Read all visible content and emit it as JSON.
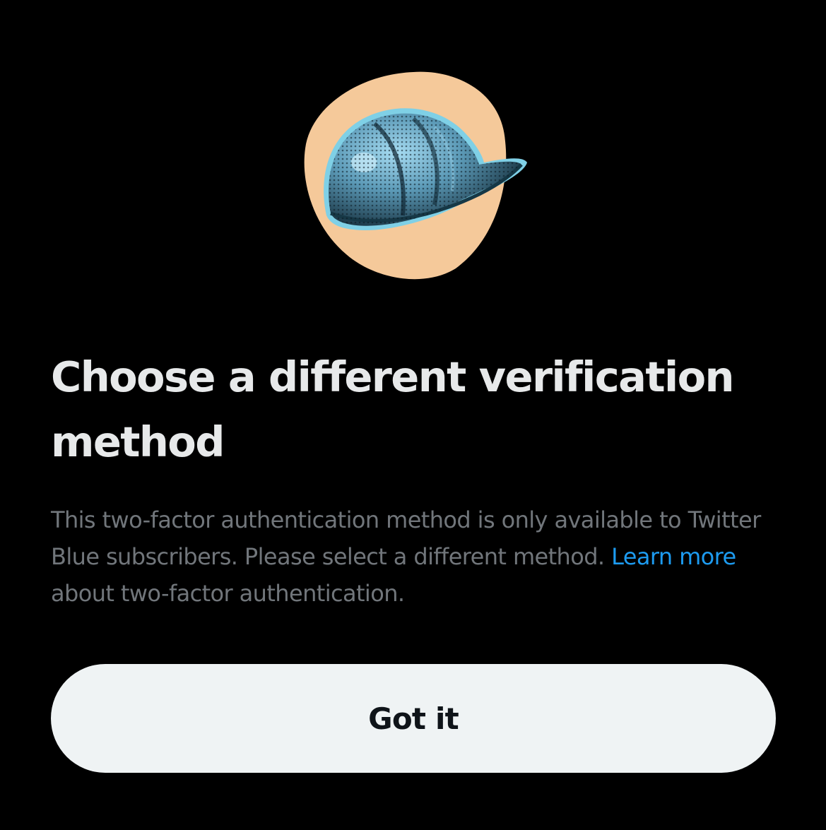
{
  "dialog": {
    "illustration_icon": "hard-hat-icon",
    "title": "Choose a different verification method",
    "body": {
      "text_before_link": "This two-factor authentication method is only available to Twitter Blue subscribers. Please select a different method. ",
      "link_text": "Learn more",
      "text_after_link": " about two-factor authentication."
    },
    "primary_button_label": "Got it"
  },
  "colors": {
    "background": "#000000",
    "title": "#e7e9ea",
    "body_text": "#71767b",
    "link": "#1d9bf0",
    "button_bg": "#eff3f4",
    "button_text": "#0f1419",
    "illustration_circle": "#f5c99a",
    "helmet": "#5a9fbf"
  }
}
